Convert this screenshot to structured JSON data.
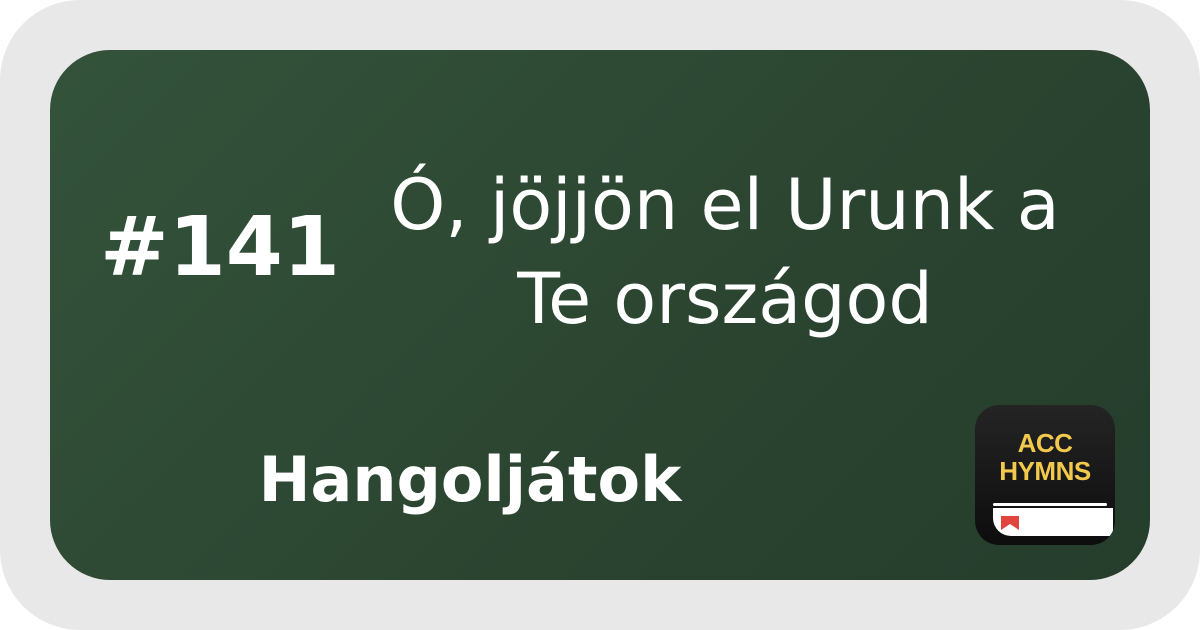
{
  "hymn": {
    "number": "#141",
    "title_line1": "Ó, jöjjön el Urunk a",
    "title_line2": "Te országod",
    "category": "Hangoljátok"
  },
  "logo": {
    "line1": "ACC",
    "line2": "HYMNS"
  },
  "colors": {
    "card_background": "#2e4a35",
    "frame_background": "#e8e8e8",
    "logo_text": "#f2c94c",
    "logo_ribbon": "#e0463f"
  }
}
